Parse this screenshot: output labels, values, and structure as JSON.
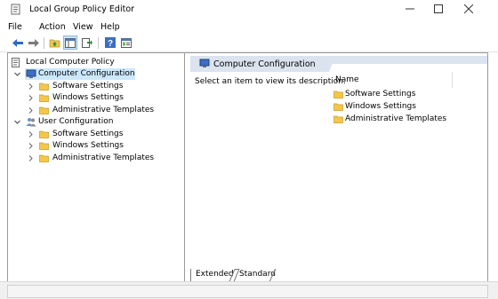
{
  "window": {
    "title": "Local Group Policy Editor"
  },
  "menu": [
    "File",
    "Action",
    "View",
    "Help"
  ],
  "tree": {
    "root": "Local Computer Policy",
    "computer": {
      "label": "Computer Configuration",
      "children": [
        "Software Settings",
        "Windows Settings",
        "Administrative Templates"
      ]
    },
    "user": {
      "label": "User Configuration",
      "children": [
        "Software Settings",
        "Windows Settings",
        "Administrative Templates"
      ]
    }
  },
  "detail": {
    "header": "Computer Configuration",
    "description": "Select an item to view its description.",
    "column": "Name",
    "items": [
      "Software Settings",
      "Windows Settings",
      "Administrative Templates"
    ]
  },
  "tabs": [
    "Extended",
    "Standard"
  ],
  "colors": {
    "selection": "#cce8ff",
    "header_band": "#dbe3ef",
    "folder": "#f3c84a",
    "accent_blue": "#1c69c7"
  }
}
